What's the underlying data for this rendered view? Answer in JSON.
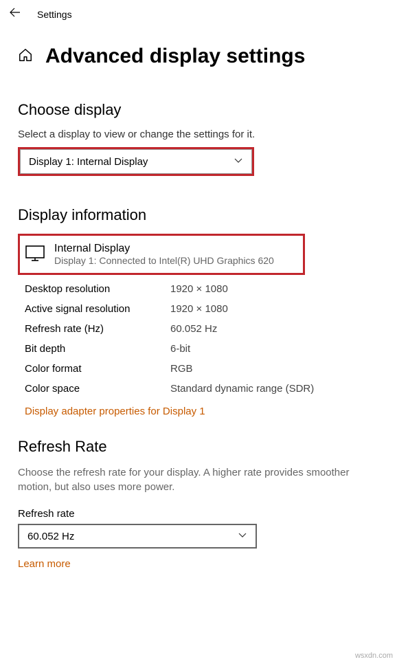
{
  "topbar": {
    "title": "Settings"
  },
  "header": {
    "title": "Advanced display settings"
  },
  "chooseDisplay": {
    "heading": "Choose display",
    "helper": "Select a display to view or change the settings for it.",
    "selected": "Display 1: Internal Display"
  },
  "displayInfo": {
    "heading": "Display information",
    "card": {
      "title": "Internal Display",
      "sub": "Display 1: Connected to Intel(R) UHD Graphics 620"
    },
    "rows": {
      "desktopResLabel": "Desktop resolution",
      "desktopResVal": "1920 × 1080",
      "activeResLabel": "Active signal resolution",
      "activeResVal": "1920 × 1080",
      "refreshLabel": "Refresh rate (Hz)",
      "refreshVal": "60.052 Hz",
      "bitDepthLabel": "Bit depth",
      "bitDepthVal": "6-bit",
      "colorFmtLabel": "Color format",
      "colorFmtVal": "RGB",
      "colorSpaceLabel": "Color space",
      "colorSpaceVal": "Standard dynamic range (SDR)"
    },
    "adapterLink": "Display adapter properties for Display 1"
  },
  "refreshRate": {
    "heading": "Refresh Rate",
    "helper": "Choose the refresh rate for your display. A higher rate provides smoother motion, but also uses more power.",
    "fieldLabel": "Refresh rate",
    "selected": "60.052 Hz",
    "learnMore": "Learn more"
  },
  "watermark": "wsxdn.com"
}
